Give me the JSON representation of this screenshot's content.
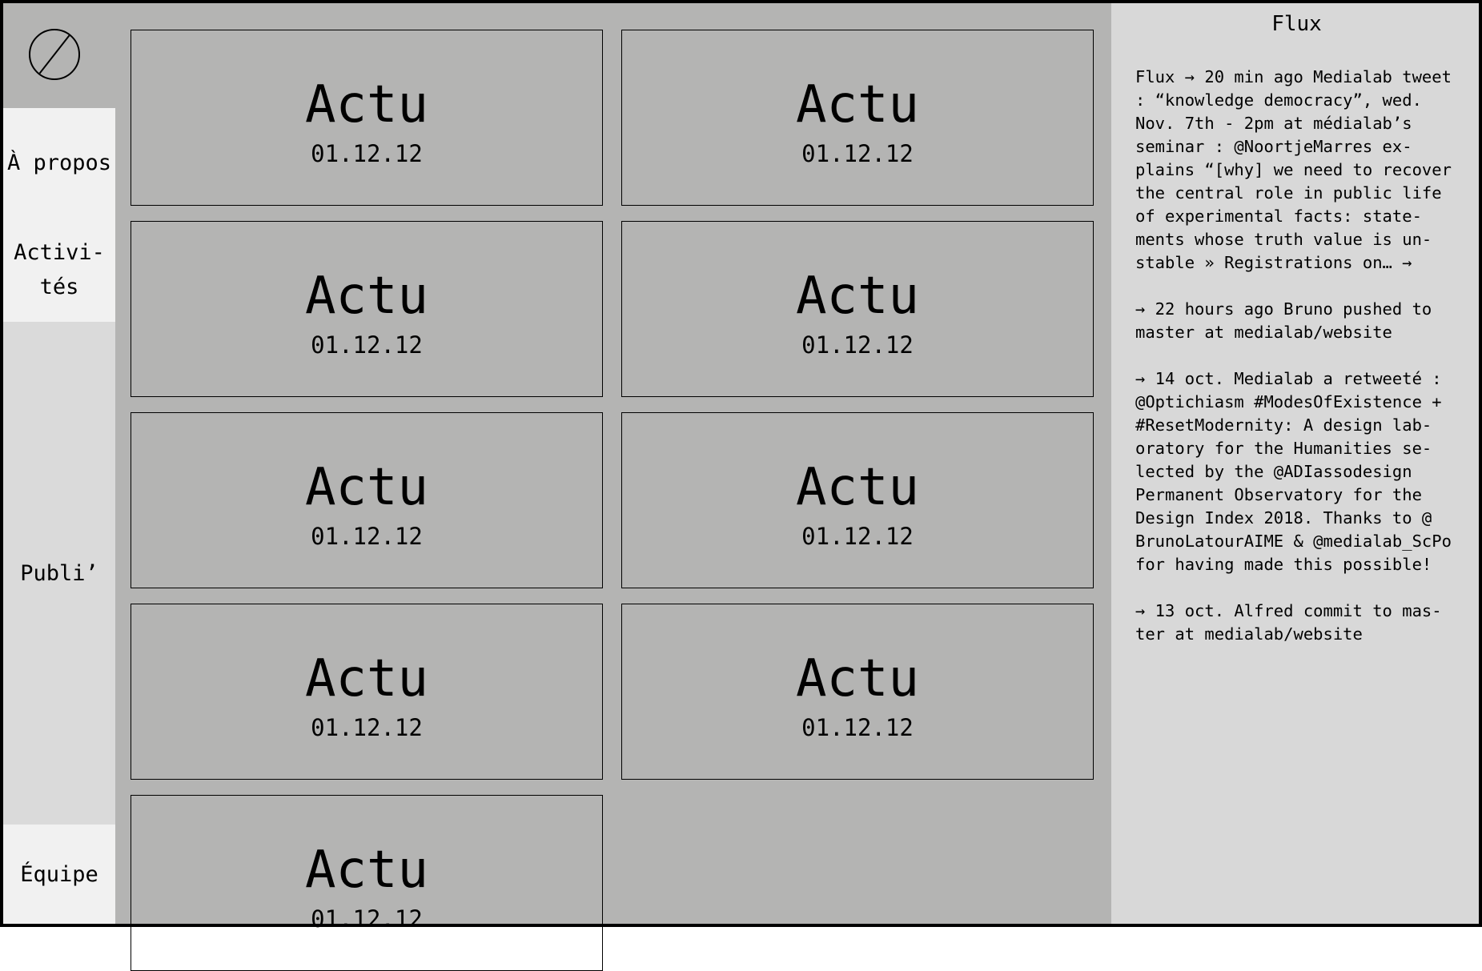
{
  "sidebar": {
    "logo_icon": "null-sign-logo",
    "items": [
      {
        "label": "À propos"
      },
      {
        "label": "Activi-\ntés"
      },
      {
        "label": "Publi’"
      },
      {
        "label": "Équipe"
      }
    ]
  },
  "cards": [
    {
      "title": "Actu",
      "date": "01.12.12"
    },
    {
      "title": "Actu",
      "date": "01.12.12"
    },
    {
      "title": "Actu",
      "date": "01.12.12"
    },
    {
      "title": "Actu",
      "date": "01.12.12"
    },
    {
      "title": "Actu",
      "date": "01.12.12"
    },
    {
      "title": "Actu",
      "date": "01.12.12"
    },
    {
      "title": "Actu",
      "date": "01.12.12"
    },
    {
      "title": "Actu",
      "date": "01.12.12"
    },
    {
      "title": "Actu",
      "date": "01.12.12"
    }
  ],
  "flux": {
    "title": "Flux",
    "entries": [
      "Flux → 20 min ago Medialab tweet : “knowledge democracy”, wed. Nov. 7th - 2pm at médialab’s seminar : @NoortjeMarres ex-plains “[why] we need to recover the central role in public life of experimental facts: state-ments whose truth value is un-stable » Registrations on… →",
      "→ 22 hours ago Bruno pushed to master at medialab/website",
      "→ 14 oct. Medialab a retweeté : @Optichiasm #ModesOfExistence + #ResetModernity: A design lab-oratory for the Humanities se-lected by the @ADIassodesign Permanent Observatory for the Design Index 2018. Thanks to @ BrunoLatourAIME & @medialab_ScPo for having made this possible!",
      "→ 13 oct. Alfred commit to mas-ter at medialab/website"
    ]
  },
  "colors": {
    "main_bg": "#b4b4b3",
    "panel_bg": "#d8d8d8",
    "nav_active_bg": "#f1f1f1",
    "nav_publi_bg": "#dadada",
    "border": "#000000"
  }
}
